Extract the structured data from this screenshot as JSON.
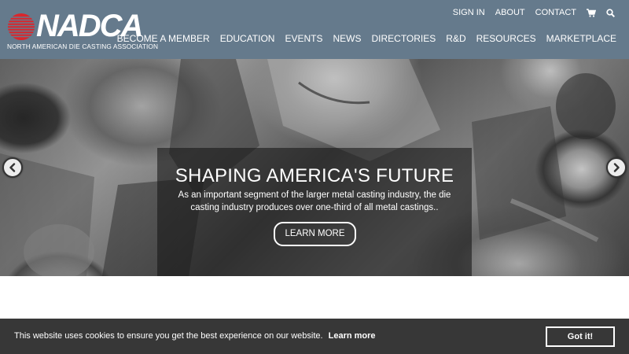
{
  "brand": {
    "logo_text": "NADCA",
    "tagline": "NORTH AMERICAN DIE CASTING ASSOCIATION",
    "logo_red": "#d9262c",
    "header_bg": "#657a8c"
  },
  "utility_nav": {
    "items": [
      "SIGN IN",
      "ABOUT",
      "CONTACT"
    ],
    "cart_icon": "cart-icon",
    "search_icon": "search-icon"
  },
  "main_nav": {
    "items": [
      "BECOME A MEMBER",
      "EDUCATION",
      "EVENTS",
      "NEWS",
      "DIRECTORIES",
      "R&D",
      "RESOURCES",
      "MARKETPLACE"
    ]
  },
  "hero": {
    "title": "SHAPING AMERICA'S FUTURE",
    "text": "As an important segment of the larger metal casting industry, the die casting industry produces over one-third of all metal castings..",
    "button_label": "LEARN MORE",
    "prev_icon": "chevron-left-icon",
    "next_icon": "chevron-right-icon"
  },
  "cookie_bar": {
    "message": "This website uses cookies to ensure you get the best experience on our website.",
    "link_label": "Learn more",
    "button_label": "Got it!",
    "bg": "#373737"
  }
}
